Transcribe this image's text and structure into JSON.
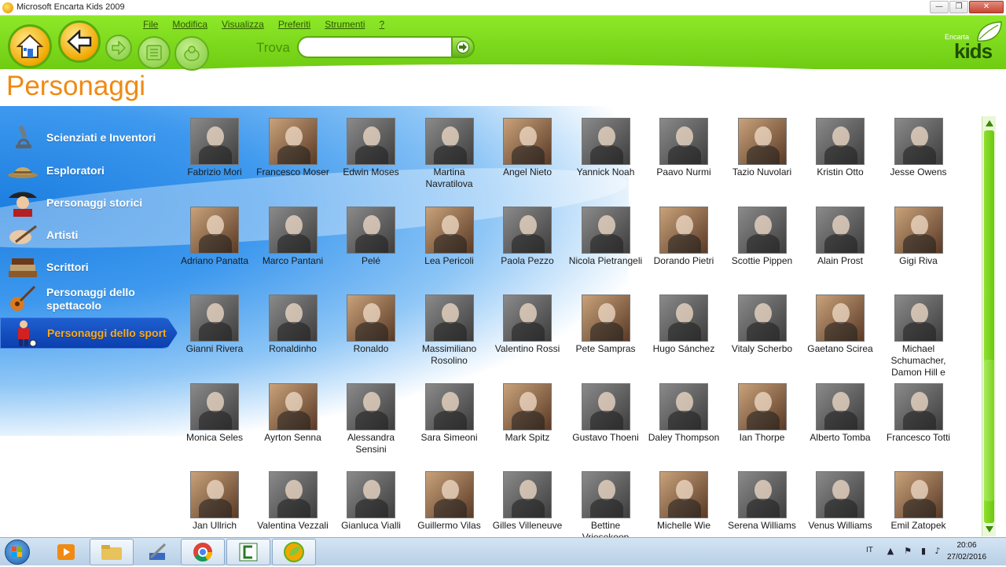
{
  "window": {
    "title": "Microsoft Encarta Kids 2009",
    "min_label": "—",
    "max_label": "❐",
    "close_label": "✕"
  },
  "menu": [
    "File",
    "Modifica",
    "Visualizza",
    "Preferiti",
    "Strumenti",
    "?"
  ],
  "search": {
    "label": "Trova",
    "value": "",
    "placeholder": ""
  },
  "logo": {
    "brand_small": "Encarta",
    "brand_big": "kids"
  },
  "page": {
    "title": "Personaggi"
  },
  "categories": [
    {
      "label": "Scienziati e Inventori",
      "icon": "microscope-icon",
      "active": false
    },
    {
      "label": "Esploratori",
      "icon": "explorer-hat-icon",
      "active": false
    },
    {
      "label": "Personaggi storici",
      "icon": "napoleon-icon",
      "active": false
    },
    {
      "label": "Artisti",
      "icon": "paintbrush-icon",
      "active": false
    },
    {
      "label": "Scrittori",
      "icon": "books-icon",
      "active": false
    },
    {
      "label": "Personaggi dello spettacolo",
      "icon": "guitar-icon",
      "active": false
    },
    {
      "label": "Personaggi dello sport",
      "icon": "footballer-icon",
      "active": true
    }
  ],
  "people": [
    [
      "Fabrizio Mori",
      "Francesco Moser",
      "Edwin Moses",
      "Martina Navratilova",
      "Angel Nieto",
      "Yannick Noah",
      "Paavo Nurmi",
      "Tazio Nuvolari",
      "Kristin Otto",
      "Jesse Owens"
    ],
    [
      "Adriano Panatta",
      "Marco Pantani",
      "Pelé",
      "Lea Pericoli",
      "Paola Pezzo",
      "Nicola Pietrangeli",
      "Dorando Pietri",
      "Scottie Pippen",
      "Alain Prost",
      "Gigi Riva"
    ],
    [
      "Gianni Rivera",
      "Ronaldinho",
      "Ronaldo",
      "Massimiliano Rosolino",
      "Valentino Rossi",
      "Pete Sampras",
      "Hugo Sánchez",
      "Vitaly Scherbo",
      "Gaetano Scirea",
      "Michael Schumacher, Damon Hill e"
    ],
    [
      "Monica Seles",
      "Ayrton Senna",
      "Alessandra Sensini",
      "Sara Simeoni",
      "Mark Spitz",
      "Gustavo Thoeni",
      "Daley Thompson",
      "Ian Thorpe",
      "Alberto Tomba",
      "Francesco Totti"
    ],
    [
      "Jan Ullrich",
      "Valentina Vezzali",
      "Gianluca Vialli",
      "Guillermo Vilas",
      "Gilles Villeneuve",
      "Bettine Vriesekoop",
      "Michelle Wie",
      "Serena Williams",
      "Venus Williams",
      "Emil Zatopek"
    ]
  ],
  "taskbar": {
    "apps": [
      {
        "name": "media-player-icon",
        "open": false
      },
      {
        "name": "file-explorer-icon",
        "open": true
      },
      {
        "name": "tools-icon",
        "open": false
      },
      {
        "name": "chrome-icon",
        "open": true
      },
      {
        "name": "camtasia-icon",
        "open": true
      },
      {
        "name": "encarta-kids-icon",
        "open": true
      }
    ],
    "language": "IT",
    "time": "20:06",
    "date": "27/02/2016"
  },
  "colors": {
    "toolbar_green": "#7ed81f",
    "title_orange": "#f08a12",
    "active_category_text": "#f8a91d",
    "active_category_bg": "#1548bd"
  }
}
